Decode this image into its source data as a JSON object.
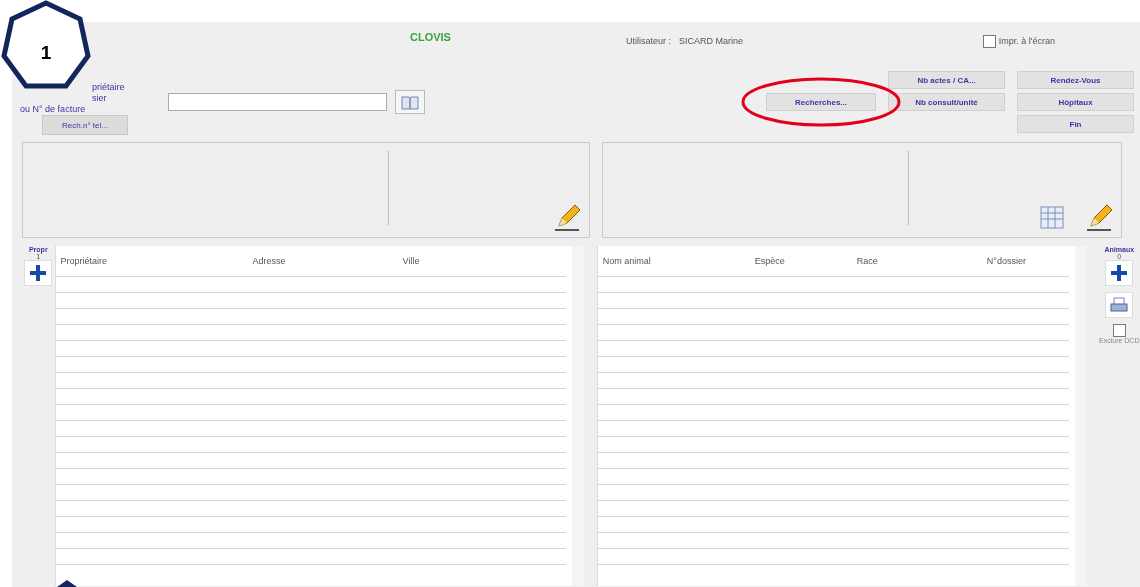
{
  "annotation": {
    "badge": "1"
  },
  "header": {
    "app_name": "CLOVIS",
    "user_label": "Utilisateur :",
    "user_name": "SICARD Marine",
    "print_option": {
      "label": "Impr. à l'écran",
      "checked": false
    }
  },
  "search": {
    "label_lines": [
      "priétaire",
      "sier",
      "ou N° de facture"
    ],
    "tab": "Rech.n° tel..."
  },
  "search_button": {
    "label": "Recherches...",
    "circled": true
  },
  "stats_buttons": [
    "Nb actes / CA...",
    "Nb consult/unité"
  ],
  "nav_buttons": [
    "Rendez-Vous",
    "Hôpitaux",
    "Fin"
  ],
  "owners": {
    "label": "Propr",
    "count": "1",
    "columns": [
      "Propriétaire",
      "Adresse",
      "Ville"
    ]
  },
  "animals": {
    "label": "Animaux",
    "count": "0",
    "columns": [
      "Nom animal",
      "Espèce",
      "Race",
      "N°dossier"
    ],
    "exclude_option": {
      "label": "Exclure DCD",
      "checked": false
    }
  }
}
